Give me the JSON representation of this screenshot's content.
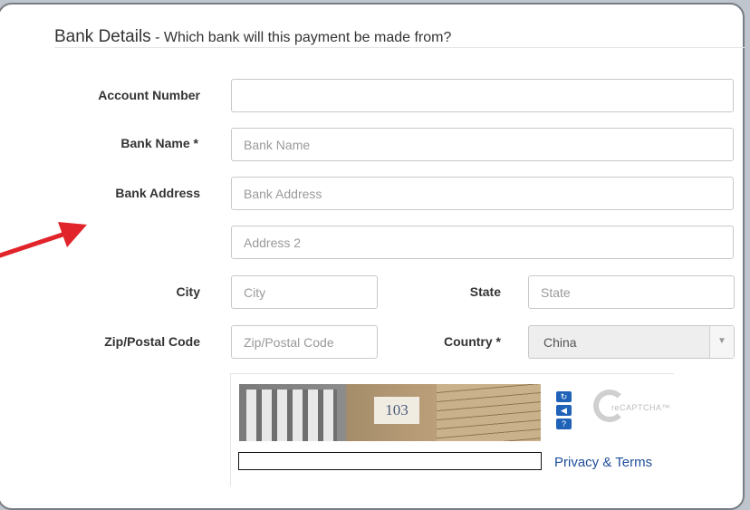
{
  "heading": {
    "title": "Bank Details",
    "subtitle": " - Which bank will this payment be made from?"
  },
  "fields": {
    "account_number": {
      "label": "Account Number",
      "value": "",
      "placeholder": ""
    },
    "bank_name": {
      "label": "Bank Name *",
      "value": "",
      "placeholder": "Bank Name"
    },
    "bank_address": {
      "label": "Bank Address",
      "value": "",
      "placeholder": "Bank Address"
    },
    "address2": {
      "value": "",
      "placeholder": "Address 2"
    },
    "city": {
      "label": "City",
      "value": "",
      "placeholder": "City"
    },
    "state": {
      "label": "State",
      "value": "",
      "placeholder": "State"
    },
    "zip": {
      "label": "Zip/Postal Code",
      "value": "",
      "placeholder": "Zip/Postal Code"
    },
    "country": {
      "label": "Country *",
      "selected": "China"
    }
  },
  "captcha": {
    "image_text": "103",
    "refresh_icon": "refresh-icon",
    "audio_icon": "audio-icon",
    "help_icon": "help-icon",
    "logo_text": "reCAPTCHA™",
    "privacy_link": "Privacy & Terms"
  },
  "annotation": {
    "arrow_color": "#e0242a"
  }
}
